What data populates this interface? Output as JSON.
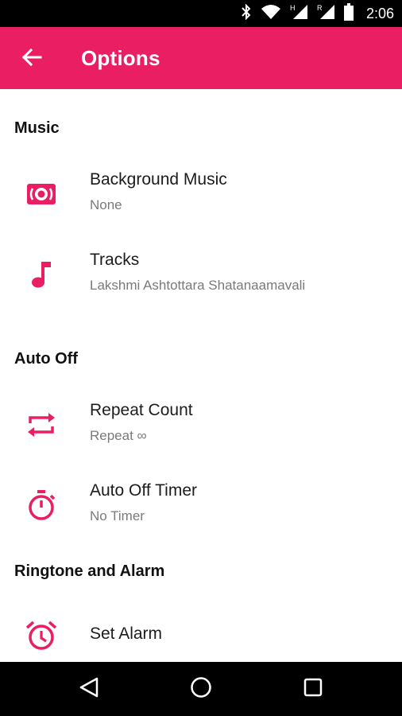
{
  "status_bar": {
    "time": "2:06",
    "icons": [
      "bluetooth-icon",
      "wifi-icon",
      "signal-h-icon",
      "signal-r-icon",
      "battery-icon"
    ]
  },
  "app_bar": {
    "title": "Options",
    "back_icon": "arrow-back-icon",
    "background": "#e91e63"
  },
  "sections": {
    "music": {
      "header": "Music",
      "background_music": {
        "title": "Background Music",
        "subtitle": "None",
        "icon": "speaker-icon"
      },
      "tracks": {
        "title": "Tracks",
        "subtitle": "Lakshmi Ashtottara Shatanaamavali",
        "icon": "music-note-icon"
      }
    },
    "auto_off": {
      "header": "Auto Off",
      "repeat_count": {
        "title": "Repeat Count",
        "subtitle": "Repeat ∞",
        "icon": "repeat-icon"
      },
      "timer": {
        "title": "Auto Off Timer",
        "subtitle": "No Timer",
        "icon": "timer-icon"
      }
    },
    "ringtone": {
      "header": "Ringtone and Alarm",
      "set_alarm": {
        "title": "Set Alarm",
        "icon": "alarm-icon"
      }
    }
  },
  "nav_bar": {
    "icons": [
      "back-triangle-icon",
      "home-circle-icon",
      "recents-square-icon"
    ]
  },
  "colors": {
    "accent": "#e91e63",
    "text_primary": "#1c1c1c",
    "text_secondary": "#7a7a7a"
  }
}
